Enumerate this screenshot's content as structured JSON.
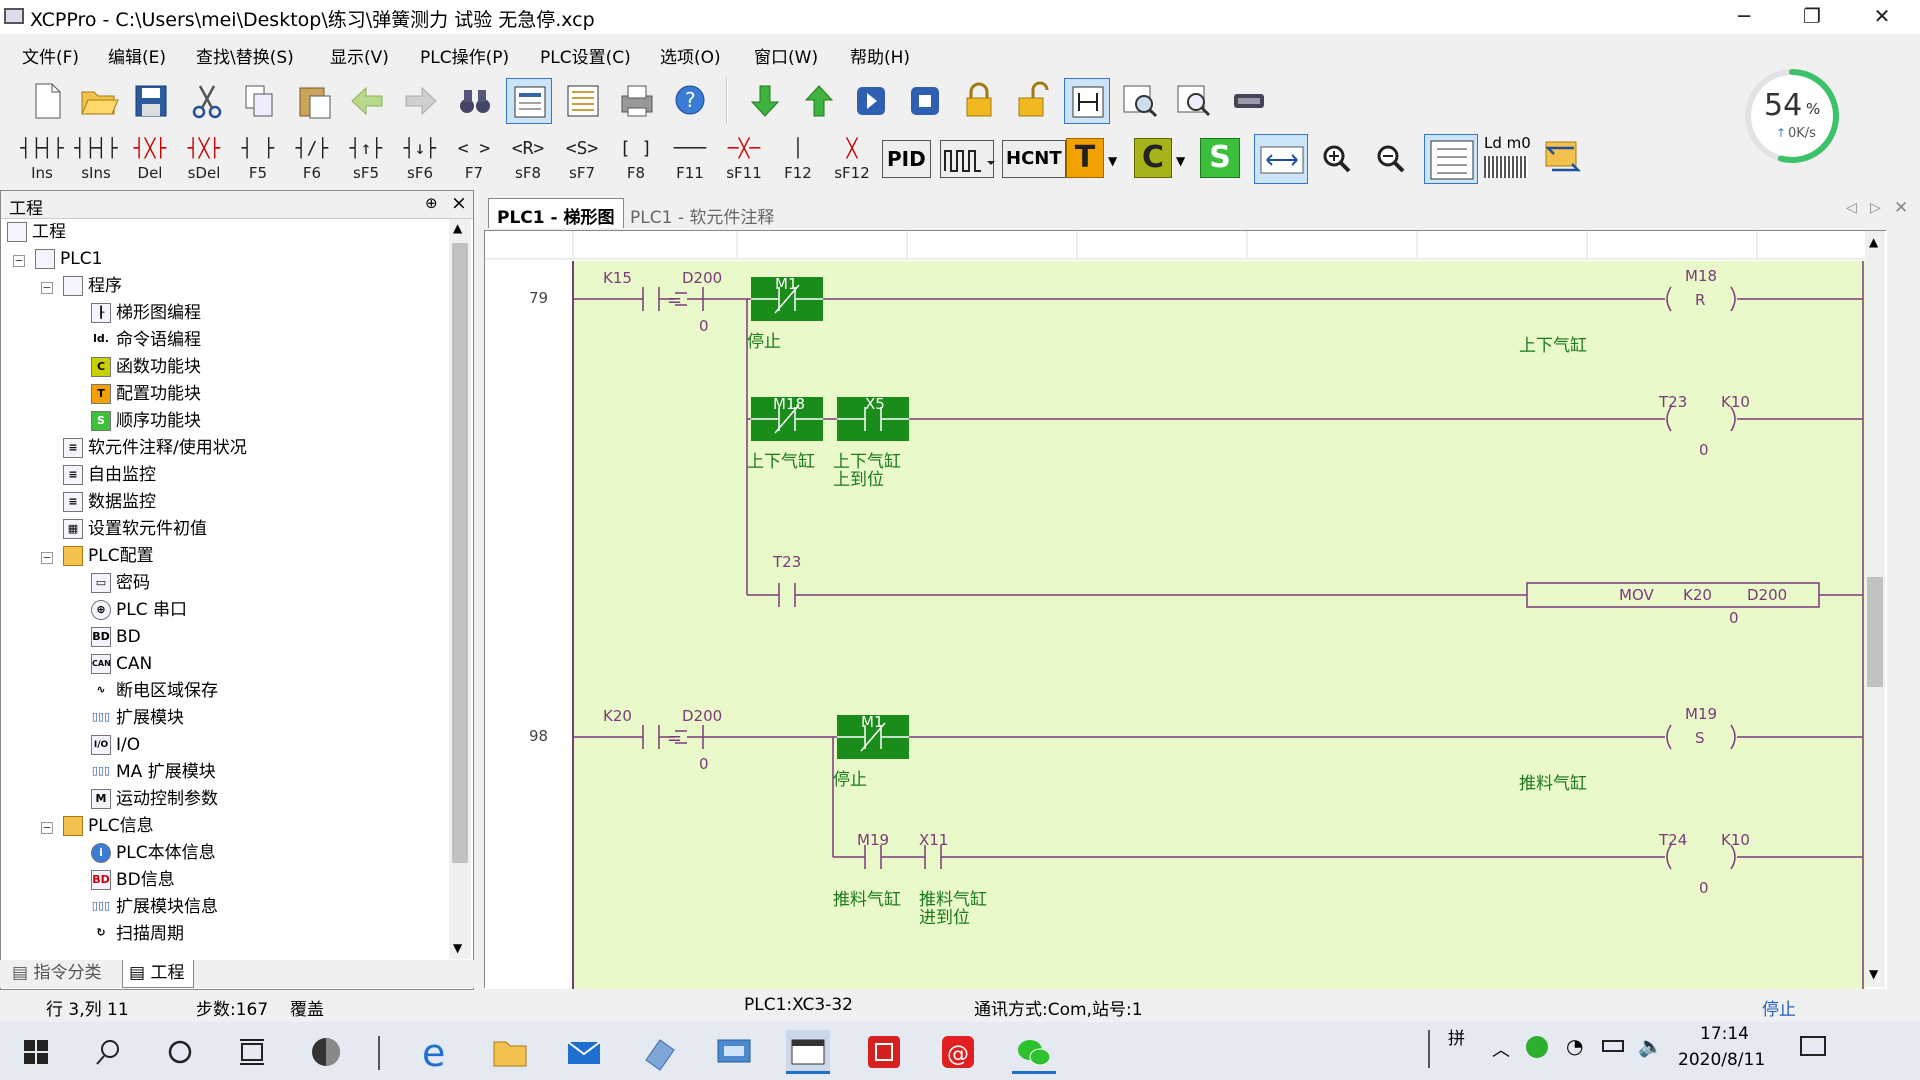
{
  "window": {
    "title": "XCPPro - C:\\Users\\mei\\Desktop\\练习\\弹簧测力 试验 无急停.xcp"
  },
  "menu": [
    "文件(F)",
    "编辑(E)",
    "查找\\替换(S)",
    "显示(V)",
    "PLC操作(P)",
    "PLC设置(C)",
    "选项(O)",
    "窗口(W)",
    "帮助(H)"
  ],
  "ladder_toolbar": [
    {
      "sym": "┤├┤├",
      "label": "Ins"
    },
    {
      "sym": "┤├┤├",
      "label": "sIns"
    },
    {
      "sym": "┤╳├",
      "label": "Del"
    },
    {
      "sym": "┤╳├",
      "label": "sDel"
    },
    {
      "sym": "┤ ├",
      "label": "F5"
    },
    {
      "sym": "┤/├",
      "label": "F6"
    },
    {
      "sym": "┤↑├",
      "label": "sF5"
    },
    {
      "sym": "┤↓├",
      "label": "sF6"
    },
    {
      "sym": "< >",
      "label": "F7"
    },
    {
      "sym": "<R>",
      "label": "sF8"
    },
    {
      "sym": "<S>",
      "label": "sF7"
    },
    {
      "sym": "[ ]",
      "label": "F8"
    },
    {
      "sym": "───",
      "label": "F11"
    },
    {
      "sym": "─╳─",
      "label": "sF11"
    },
    {
      "sym": " │ ",
      "label": "F12"
    },
    {
      "sym": " ╳ ",
      "label": "sF12"
    }
  ],
  "ladder_toolbar_text": {
    "pid": "PID",
    "hcnt": "HCNT",
    "t": "T",
    "c": "C",
    "s": "S",
    "ldm0": "Ld m0"
  },
  "gauge": {
    "percent": "54",
    "percent_unit": "%",
    "speed": "0K/s",
    "fill_fraction": 0.54
  },
  "panel": {
    "title": "工程",
    "pin": "⊕",
    "close": "×",
    "tree": [
      {
        "label": "工程",
        "level": 0,
        "icon": "project-icon"
      },
      {
        "label": "PLC1",
        "level": 1,
        "icon": "plc-icon"
      },
      {
        "label": "程序",
        "level": 2,
        "icon": "program-icon"
      },
      {
        "label": "梯形图编程",
        "level": 3,
        "icon": "ladder-icon"
      },
      {
        "label": "命令语编程",
        "level": 3,
        "icon": "instruction-icon"
      },
      {
        "label": "函数功能块",
        "level": 3,
        "icon": "function-block-icon"
      },
      {
        "label": "配置功能块",
        "level": 3,
        "icon": "config-block-icon"
      },
      {
        "label": "顺序功能块",
        "level": 3,
        "icon": "sequence-block-icon"
      },
      {
        "label": "软元件注释/使用状况",
        "level": 2,
        "icon": "comment-icon"
      },
      {
        "label": "自由监控",
        "level": 2,
        "icon": "monitor-icon"
      },
      {
        "label": "数据监控",
        "level": 2,
        "icon": "data-monitor-icon"
      },
      {
        "label": "设置软元件初值",
        "level": 2,
        "icon": "init-value-icon"
      },
      {
        "label": "PLC配置",
        "level": 2,
        "icon": "folder-icon"
      },
      {
        "label": "密码",
        "level": 3,
        "icon": "password-icon"
      },
      {
        "label": "PLC 串口",
        "level": 3,
        "icon": "serial-port-icon"
      },
      {
        "label": "BD",
        "level": 3,
        "icon": "bd-icon"
      },
      {
        "label": "CAN",
        "level": 3,
        "icon": "can-icon"
      },
      {
        "label": "断电区域保存",
        "level": 3,
        "icon": "power-save-icon"
      },
      {
        "label": "扩展模块",
        "level": 3,
        "icon": "expansion-icon"
      },
      {
        "label": "I/O",
        "level": 3,
        "icon": "io-icon"
      },
      {
        "label": "MA 扩展模块",
        "level": 3,
        "icon": "ma-expansion-icon"
      },
      {
        "label": "运动控制参数",
        "level": 3,
        "icon": "motion-icon"
      },
      {
        "label": "PLC信息",
        "level": 2,
        "icon": "folder-icon"
      },
      {
        "label": "PLC本体信息",
        "level": 3,
        "icon": "plc-info-icon"
      },
      {
        "label": "BD信息",
        "level": 3,
        "icon": "bd-info-icon"
      },
      {
        "label": "扩展模块信息",
        "level": 3,
        "icon": "expansion-info-icon"
      },
      {
        "label": "扫描周期",
        "level": 3,
        "icon": "scan-cycle-icon"
      }
    ],
    "bottom_tabs": [
      "指令分类",
      "工程"
    ]
  },
  "doc_tabs": [
    "PLC1 - 梯形图",
    "PLC1 - 软元件注释"
  ],
  "ladder": {
    "rung1": {
      "step": "79",
      "cmp": {
        "a": "K15",
        "op": "=",
        "b": "D200",
        "val": "0"
      },
      "m1": {
        "name": "M1",
        "comment": "停止"
      },
      "coil": {
        "name": "M18",
        "type": "R",
        "comment": "上下气缸"
      },
      "branch1": {
        "c1": "M18",
        "c1_comment": "上下气缸",
        "c2": "X5",
        "c2_comment1": "上下气缸",
        "c2_comment2": "上到位",
        "timer": "T23",
        "preset": "K10",
        "val": "0"
      },
      "branch2": {
        "contact": "T23",
        "mov": "MOV",
        "src": "K20",
        "dst": "D200",
        "val": "0"
      }
    },
    "rung2": {
      "step": "98",
      "cmp": {
        "a": "K20",
        "op": "=",
        "b": "D200",
        "val": "0"
      },
      "m1": {
        "name": "M1",
        "comment": "停止"
      },
      "coil": {
        "name": "M19",
        "type": "S",
        "comment": "推料气缸"
      },
      "branch1": {
        "c1": "M19",
        "c1_comment": "推料气缸",
        "c2": "X11",
        "c2_comment1": "推料气缸",
        "c2_comment2": "进到位",
        "timer": "T24",
        "preset": "K10",
        "val": "0"
      }
    }
  },
  "status": {
    "position": "行 3,列 11",
    "steps": "步数:167",
    "mode": "覆盖",
    "plc": "PLC1:XC3-32",
    "comm": "通讯方式:Com,站号:1",
    "run_state": "停止"
  },
  "taskbar": {
    "time": "17:14",
    "date": "2020/8/11",
    "ime": "拼"
  },
  "colors": {
    "ladder_bg": "#eaf9c9",
    "ladder_line": "#7a3b7a",
    "active_contact": "#1a8c1a",
    "comment": "#1a7a1a"
  }
}
